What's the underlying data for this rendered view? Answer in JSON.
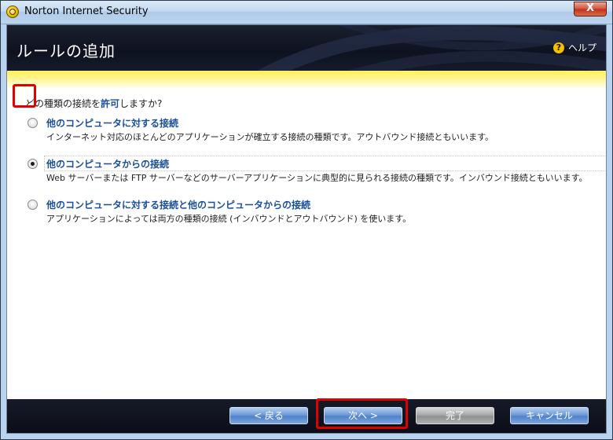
{
  "window": {
    "title": "Norton Internet Security",
    "close_label": "X"
  },
  "header": {
    "title": "ルールの追加",
    "help_label": "ヘルプ"
  },
  "question": {
    "prefix": "どの種類の接続を",
    "highlight": "許可",
    "suffix": "しますか?"
  },
  "options": [
    {
      "title": "他のコンピュータに対する接続",
      "description": "インターネット対応のほとんどのアプリケーションが確立する接続の種類です。アウトバウンド接続ともいいます。",
      "selected": false
    },
    {
      "title": "他のコンピュータからの接続",
      "description": "Web サーバーまたは FTP サーバーなどのサーバーアプリケーションに典型的に見られる接続の種類です。インバウンド接続ともいいます。",
      "selected": true
    },
    {
      "title": "他のコンピュータに対する接続と他のコンピュータからの接続",
      "description": "アプリケーションによっては両方の種類の接続 (インバウンドとアウトバウンド) を使います。",
      "selected": false
    }
  ],
  "footer": {
    "back_label": "< 戻る",
    "next_label": "次へ >",
    "finish_label": "完了",
    "cancel_label": "キャンセル"
  },
  "colors": {
    "highlight_box": "#e00000",
    "link_blue": "#1a4f9c",
    "header_bg": "#0e1220",
    "band_yellow": "#fff15a"
  }
}
